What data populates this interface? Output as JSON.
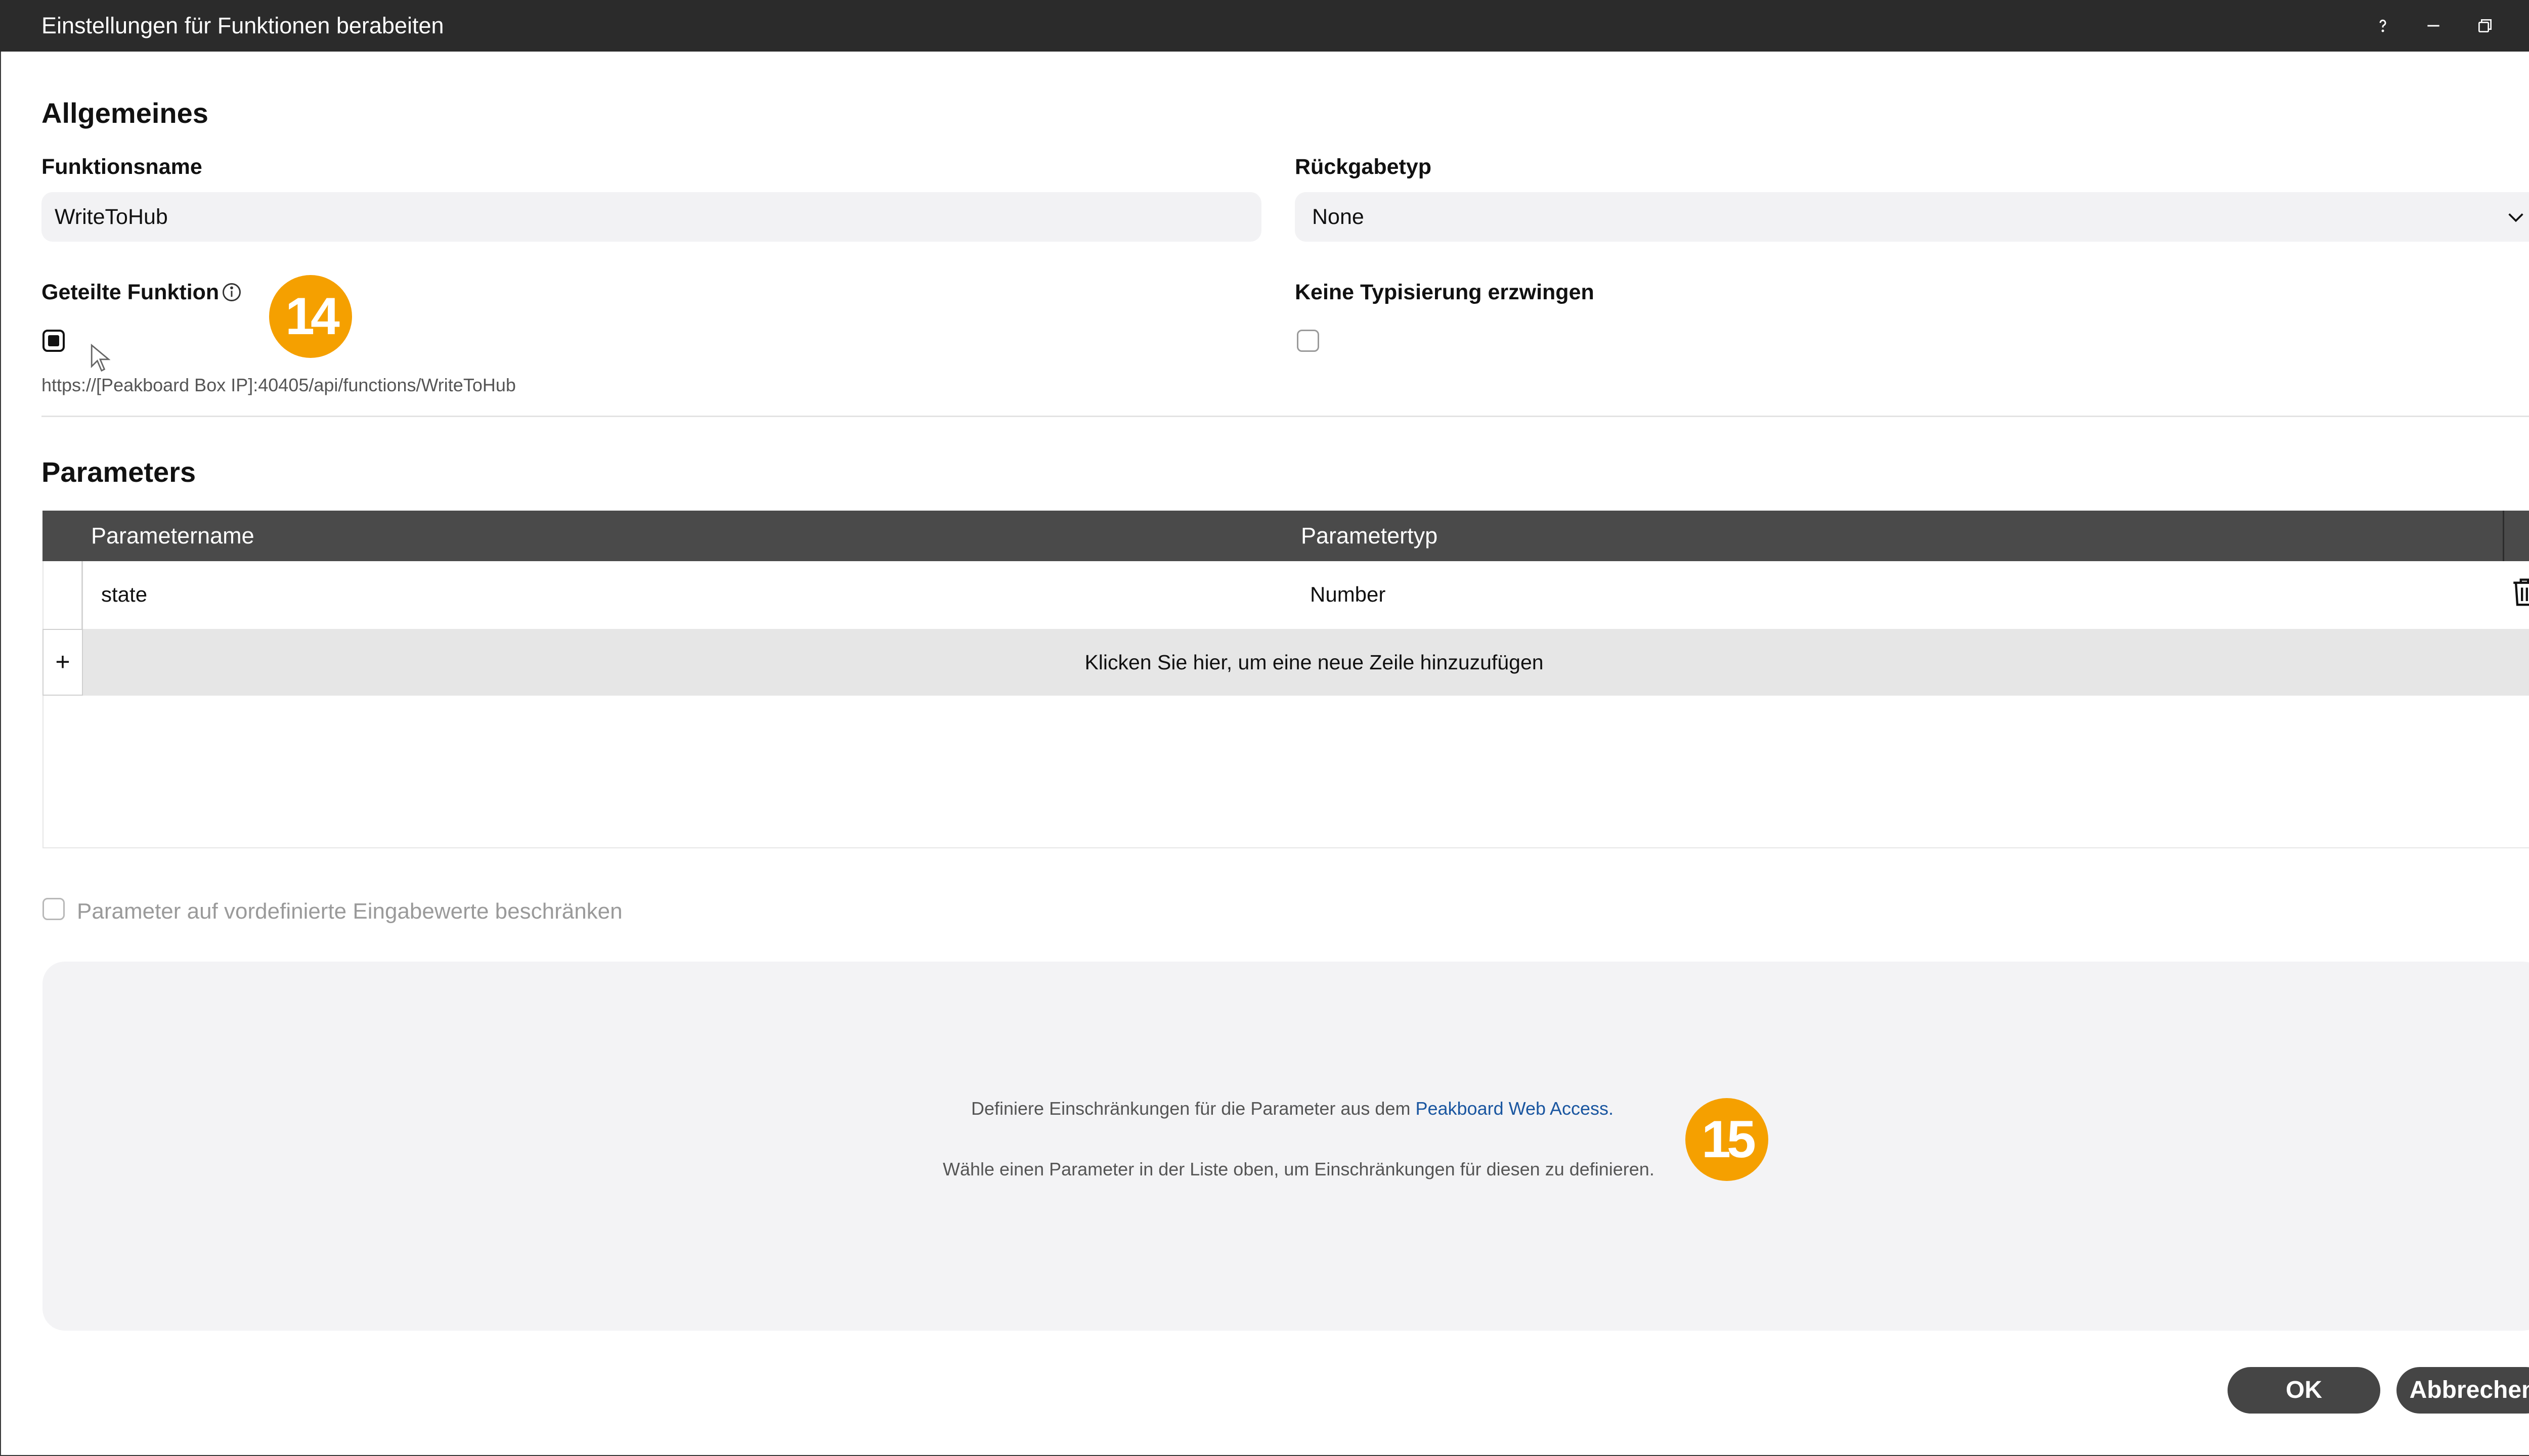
{
  "window": {
    "title": "Einstellungen für Funktionen berabeiten",
    "controls": [
      "help-icon",
      "minimize-icon",
      "restore-icon",
      "close-icon"
    ]
  },
  "general": {
    "heading": "Allgemeines",
    "function_name_label": "Funktionsname",
    "function_name_value": "WriteToHub",
    "return_type_label": "Rückgabetyp",
    "return_type_value": "None",
    "shared_label": "Geteilte Funktion",
    "shared_checked": true,
    "shared_url": "https://[Peakboard Box IP]:40405/api/functions/WriteToHub",
    "no_typing_label": "Keine Typisierung erzwingen",
    "no_typing_checked": false
  },
  "annotations": {
    "badge_14": "14",
    "badge_15": "15",
    "accent_color": "#f5a000"
  },
  "parameters": {
    "heading": "Parameters",
    "columns": [
      "Parametername",
      "Parametertyp"
    ],
    "rows": [
      {
        "name": "state",
        "type": "Number"
      }
    ],
    "add_row_text": "Klicken Sie hier, um eine neue Zeile hinzuzufügen",
    "add_row_symbol": "+",
    "restrict_label": "Parameter auf vordefinierte Eingabewerte beschränken",
    "restrict_checked": false
  },
  "restrictions_panel": {
    "line1_prefix": "Definiere Einschränkungen für die Parameter aus dem",
    "line1_link": "Peakboard Web Access.",
    "line2": "Wähle einen Parameter in der Liste oben, um Einschränkungen für diesen zu definieren."
  },
  "footer": {
    "ok_label": "OK",
    "cancel_label": "Abbrechen"
  }
}
